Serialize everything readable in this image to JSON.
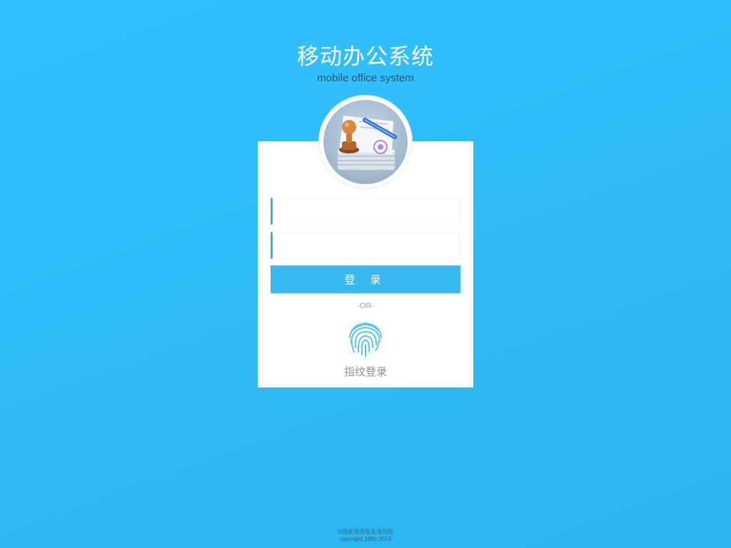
{
  "header": {
    "title": "移动办公系统",
    "subtitle": "mobile office system"
  },
  "login": {
    "username_value": "",
    "password_value": "",
    "submit_label": "登 录",
    "divider": "-OR-",
    "fingerprint_label": "指纹登录"
  },
  "footer": {
    "line1": "©国家海洋局东海分局",
    "line2": "copyright 198x-2014"
  },
  "theme": {
    "background": "#33c2ff",
    "accent": "#3ab8f0",
    "card": "#ffffff"
  },
  "icons": {
    "app": "stamp-documents-icon",
    "fingerprint": "fingerprint-icon"
  }
}
